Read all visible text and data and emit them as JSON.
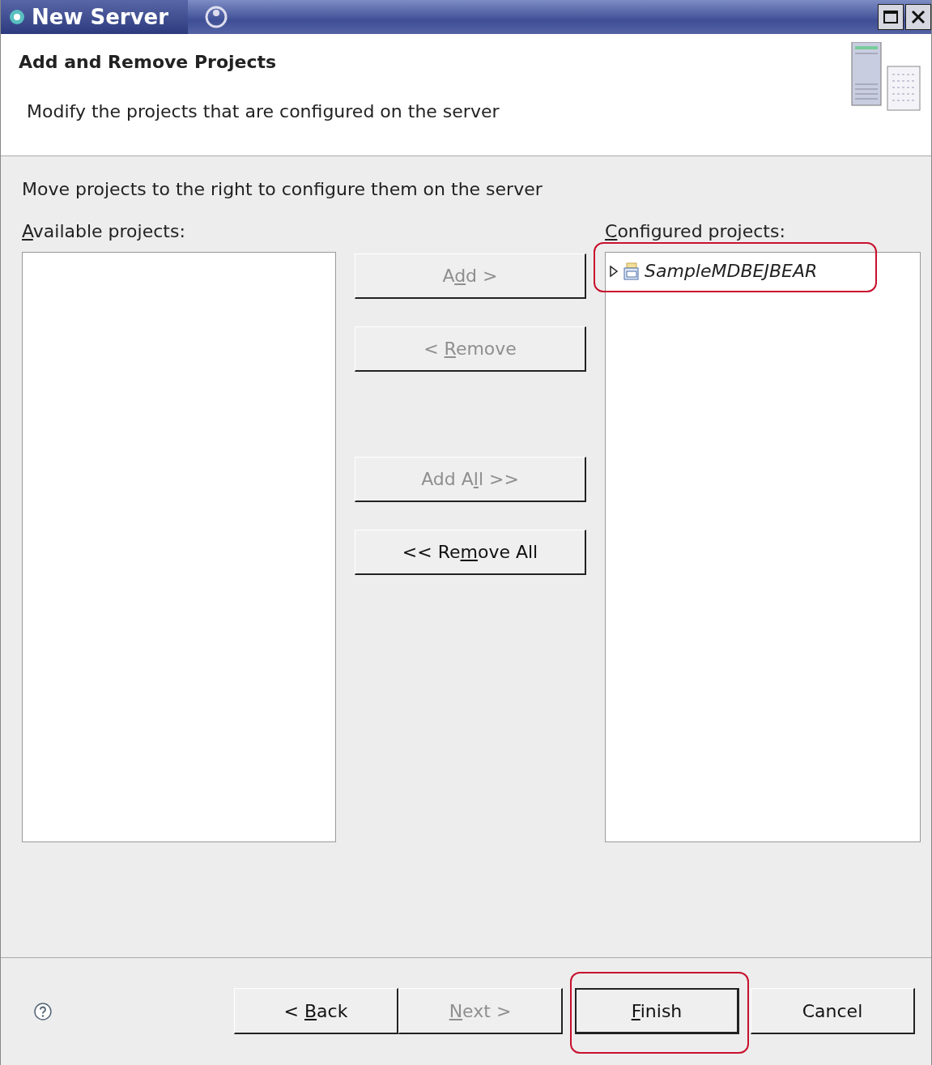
{
  "window": {
    "title": "New Server"
  },
  "header": {
    "title": "Add and Remove Projects",
    "description": "Modify the projects that are configured on the server"
  },
  "instruction": "Move projects to the right to configure them on the server",
  "available": {
    "label": {
      "key": "A",
      "post": "vailable projects:"
    }
  },
  "configured": {
    "label": {
      "key": "C",
      "post": "onfigured projects:"
    },
    "items": [
      {
        "name": "SampleMDBEJBEAR",
        "expanded": false,
        "highlighted": true
      }
    ]
  },
  "move_buttons": [
    {
      "label": {
        "pre": "A",
        "key": "d",
        "post": "d >"
      },
      "disabled": true
    },
    {
      "label": {
        "pre": "< ",
        "key": "R",
        "post": "emove"
      },
      "disabled": true
    },
    {
      "label": {
        "pre": "Add A",
        "key": "l",
        "post": "l >>"
      },
      "disabled": true
    },
    {
      "label": {
        "pre": "<< Re",
        "key": "m",
        "post": "ove All"
      },
      "disabled": false
    }
  ],
  "footer_buttons": [
    {
      "label": {
        "pre": "< ",
        "key": "B",
        "post": "ack"
      },
      "disabled": false,
      "highlighted": false
    },
    {
      "label": {
        "key": "N",
        "post": "ext >"
      },
      "disabled": true,
      "highlighted": false
    },
    {
      "label": {
        "key": "F",
        "post": "inish"
      },
      "disabled": false,
      "highlighted": true,
      "default": true
    },
    {
      "label": {
        "pre": "Cancel"
      },
      "disabled": false,
      "highlighted": false
    }
  ]
}
